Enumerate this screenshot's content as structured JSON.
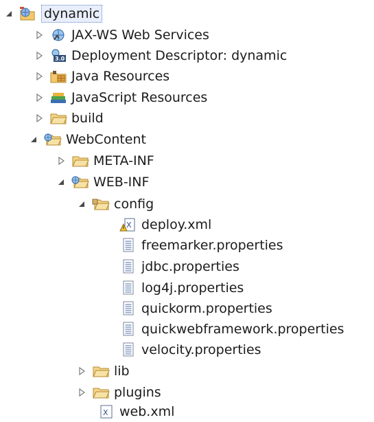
{
  "tree": {
    "root": {
      "label": "dynamic",
      "icon": "web-project-icon"
    },
    "items": [
      {
        "label": "JAX-WS Web Services",
        "icon": "web-services-icon"
      },
      {
        "label": "Deployment Descriptor: dynamic",
        "icon": "deployment-descriptor-icon",
        "badge": "3.0"
      },
      {
        "label": "Java Resources",
        "icon": "java-resources-icon"
      },
      {
        "label": "JavaScript Resources",
        "icon": "javascript-resources-icon"
      },
      {
        "label": "build",
        "icon": "folder-icon"
      },
      {
        "label": "WebContent",
        "icon": "web-folder-icon"
      },
      {
        "label": "META-INF",
        "icon": "folder-icon"
      },
      {
        "label": "WEB-INF",
        "icon": "web-folder-icon"
      },
      {
        "label": "config",
        "icon": "package-folder-icon"
      },
      {
        "label": "deploy.xml",
        "icon": "xml-warning-icon"
      },
      {
        "label": "freemarker.properties",
        "icon": "properties-file-icon"
      },
      {
        "label": "jdbc.properties",
        "icon": "properties-file-icon"
      },
      {
        "label": "log4j.properties",
        "icon": "properties-file-icon"
      },
      {
        "label": "quickorm.properties",
        "icon": "properties-file-icon"
      },
      {
        "label": "quickwebframework.properties",
        "icon": "properties-file-icon"
      },
      {
        "label": "velocity.properties",
        "icon": "properties-file-icon"
      },
      {
        "label": "lib",
        "icon": "folder-icon"
      },
      {
        "label": "plugins",
        "icon": "folder-icon"
      },
      {
        "label": "web.xml",
        "icon": "xml-file-icon"
      }
    ]
  },
  "colors": {
    "selection_border": "#5c86c7",
    "selection_fill": "#e8eefb",
    "folder_yellow": "#f2c86b",
    "text": "#1b1b1b"
  }
}
